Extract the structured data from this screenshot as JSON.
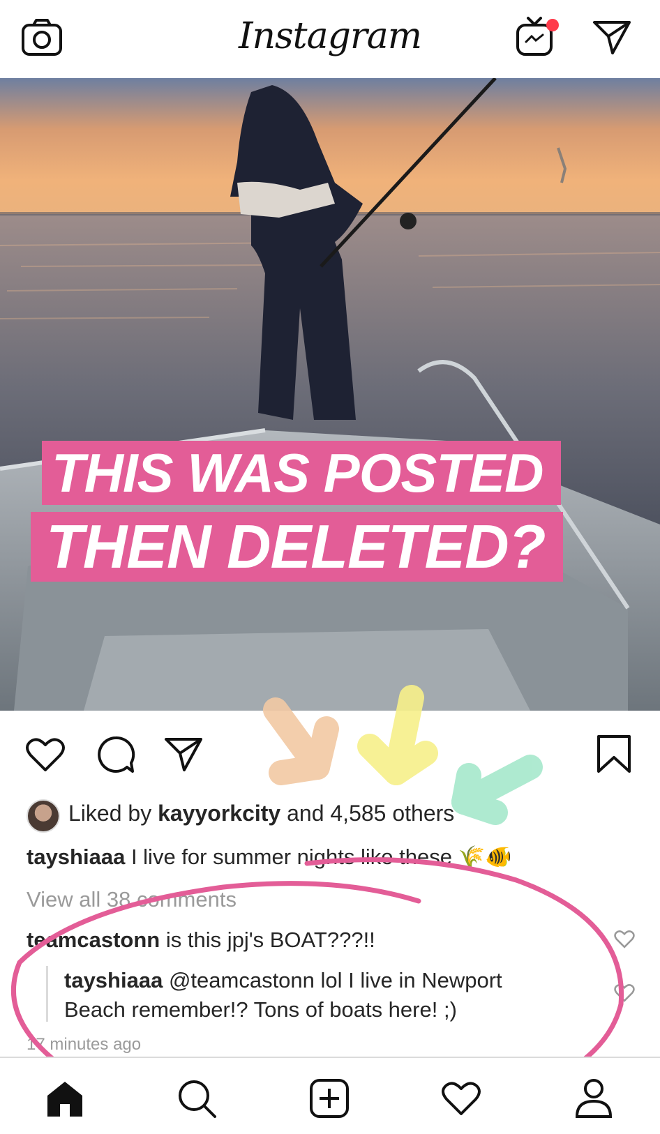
{
  "app": {
    "title": "Instagram"
  },
  "overlay": {
    "line1": "THIS WAS POSTED",
    "line2": "THEN DELETED?"
  },
  "likes": {
    "prefix": "Liked by ",
    "user": "kayyorkcity",
    "middle": " and 4,585 ",
    "suffix": "others"
  },
  "caption": {
    "user": "tayshiaaa",
    "text": " I live for summer nights like these 🌾🐠"
  },
  "view_all": "View all 38 comments",
  "comments": [
    {
      "user": "teamcastonn",
      "text": " is this jpj's BOAT???!!"
    },
    {
      "user": "tayshiaaa",
      "text": " @teamcastonn lol I live in Newport",
      "text2": "Beach remember!? Tons of boats here! ;)"
    }
  ],
  "timestamp": "17 minutes ago",
  "icons": [
    "camera-icon",
    "igtv-icon",
    "direct-icon",
    "heart-icon",
    "comment-icon",
    "share-icon",
    "bookmark-icon",
    "home-icon",
    "search-icon",
    "add-post-icon",
    "activity-icon",
    "profile-icon"
  ],
  "colors": {
    "banner": "#e35d97",
    "annotation": "#e35d97",
    "arrow_peach": "#f2c9a4",
    "arrow_yellow": "#f7f08a",
    "arrow_mint": "#a6e8cc",
    "notification": "#ff3b4b"
  }
}
